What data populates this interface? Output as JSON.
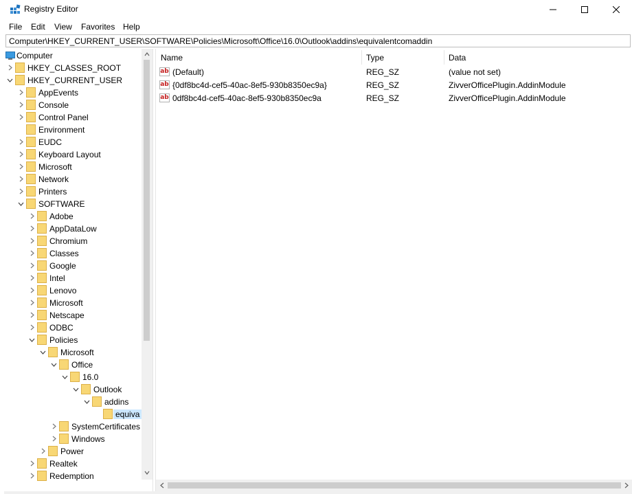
{
  "window": {
    "title": "Registry Editor",
    "controls": {
      "minimize": "minimize-icon",
      "maximize": "maximize-icon",
      "close": "close-icon"
    }
  },
  "menu": [
    "File",
    "Edit",
    "View",
    "Favorites",
    "Help"
  ],
  "address": "Computer\\HKEY_CURRENT_USER\\SOFTWARE\\Policies\\Microsoft\\Office\\16.0\\Outlook\\addins\\equivalentcomaddin",
  "tree": {
    "root": "Computer",
    "items": [
      {
        "label": "HKEY_CLASSES_ROOT",
        "level": 1,
        "expander": "collapsed"
      },
      {
        "label": "HKEY_CURRENT_USER",
        "level": 1,
        "expander": "expanded"
      },
      {
        "label": "AppEvents",
        "level": 2,
        "expander": "collapsed"
      },
      {
        "label": "Console",
        "level": 2,
        "expander": "collapsed"
      },
      {
        "label": "Control Panel",
        "level": 2,
        "expander": "collapsed"
      },
      {
        "label": "Environment",
        "level": 2,
        "expander": "none"
      },
      {
        "label": "EUDC",
        "level": 2,
        "expander": "collapsed"
      },
      {
        "label": "Keyboard Layout",
        "level": 2,
        "expander": "collapsed"
      },
      {
        "label": "Microsoft",
        "level": 2,
        "expander": "collapsed"
      },
      {
        "label": "Network",
        "level": 2,
        "expander": "collapsed"
      },
      {
        "label": "Printers",
        "level": 2,
        "expander": "collapsed"
      },
      {
        "label": "SOFTWARE",
        "level": 2,
        "expander": "expanded"
      },
      {
        "label": "Adobe",
        "level": 3,
        "expander": "collapsed"
      },
      {
        "label": "AppDataLow",
        "level": 3,
        "expander": "collapsed"
      },
      {
        "label": "Chromium",
        "level": 3,
        "expander": "collapsed"
      },
      {
        "label": "Classes",
        "level": 3,
        "expander": "collapsed"
      },
      {
        "label": "Google",
        "level": 3,
        "expander": "collapsed"
      },
      {
        "label": "Intel",
        "level": 3,
        "expander": "collapsed"
      },
      {
        "label": "Lenovo",
        "level": 3,
        "expander": "collapsed"
      },
      {
        "label": "Microsoft",
        "level": 3,
        "expander": "collapsed"
      },
      {
        "label": "Netscape",
        "level": 3,
        "expander": "collapsed"
      },
      {
        "label": "ODBC",
        "level": 3,
        "expander": "collapsed"
      },
      {
        "label": "Policies",
        "level": 3,
        "expander": "expanded"
      },
      {
        "label": "Microsoft",
        "level": 4,
        "expander": "expanded"
      },
      {
        "label": "Office",
        "level": 5,
        "expander": "expanded"
      },
      {
        "label": "16.0",
        "level": 6,
        "expander": "expanded"
      },
      {
        "label": "Outlook",
        "level": 7,
        "expander": "expanded"
      },
      {
        "label": "addins",
        "level": 8,
        "expander": "expanded"
      },
      {
        "label": "equiva",
        "level": 9,
        "expander": "none",
        "selected": true
      },
      {
        "label": "SystemCertificates",
        "level": 5,
        "expander": "collapsed"
      },
      {
        "label": "Windows",
        "level": 5,
        "expander": "collapsed"
      },
      {
        "label": "Power",
        "level": 4,
        "expander": "collapsed"
      },
      {
        "label": "Realtek",
        "level": 3,
        "expander": "collapsed"
      },
      {
        "label": "Redemption",
        "level": 3,
        "expander": "collapsed"
      }
    ]
  },
  "list": {
    "columns": {
      "name": "Name",
      "type": "Type",
      "data": "Data"
    },
    "rows": [
      {
        "name": "(Default)",
        "type": "REG_SZ",
        "data": "(value not set)",
        "icon": "string-value-icon"
      },
      {
        "name": "{0df8bc4d-cef5-40ac-8ef5-930b8350ec9a}",
        "type": "REG_SZ",
        "data": "ZivverOfficePlugin.AddinModule",
        "icon": "string-value-icon"
      },
      {
        "name": "0df8bc4d-cef5-40ac-8ef5-930b8350ec9a",
        "type": "REG_SZ",
        "data": "ZivverOfficePlugin.AddinModule",
        "icon": "string-value-icon"
      }
    ]
  },
  "colors": {
    "selection": "#cce8ff",
    "folder": "#f8d775",
    "folder_edge": "#dcb048",
    "accent": "#0078d7"
  }
}
